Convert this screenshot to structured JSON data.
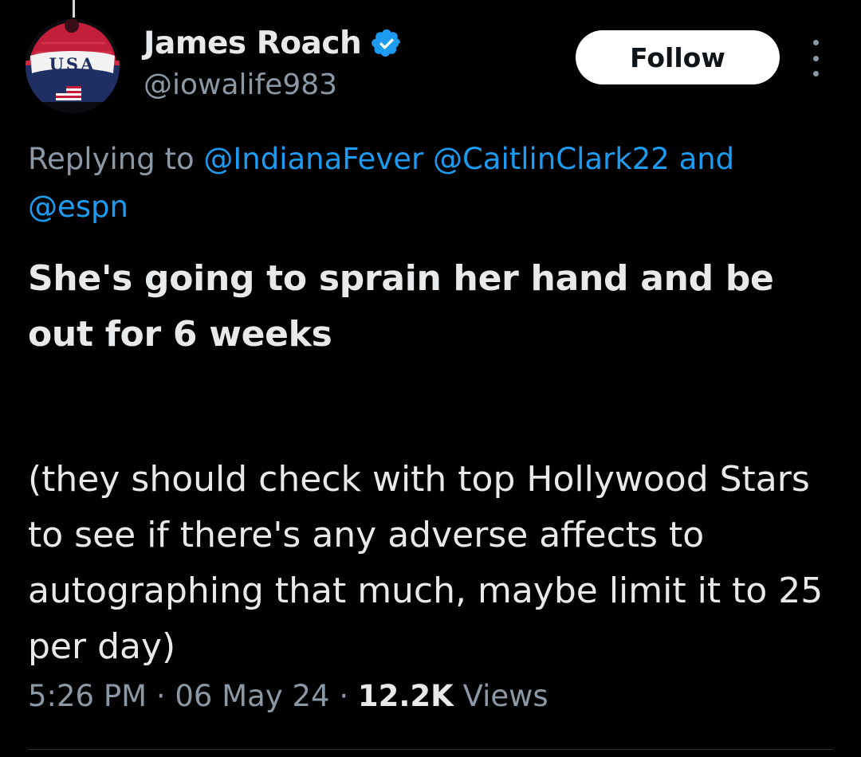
{
  "author": {
    "display_name": "James Roach",
    "handle": "@iowalife983",
    "verified": true,
    "avatar_text": "USA"
  },
  "actions": {
    "follow_label": "Follow",
    "more_icon": "more-vertical-icon"
  },
  "reply_context": {
    "prefix": "Replying to",
    "mentions": [
      "@IndianaFever",
      "@CaitlinClark22",
      "@espn"
    ],
    "conjunction": "and"
  },
  "tweet": {
    "paragraph1": "She's going to sprain her hand and be out for 6 weeks",
    "paragraph2": "(they should check with top Hollywood Stars to see if there's any adverse affects to autographing that much, maybe limit it to 25 per day)"
  },
  "meta": {
    "time": "5:26 PM",
    "separator": "·",
    "date": "06 May 24",
    "views_count": "12.2K",
    "views_label": "Views"
  },
  "colors": {
    "background": "#000000",
    "text_primary": "#e7e9ea",
    "text_secondary": "#8b98a5",
    "link": "#1d9bf0",
    "verified_badge": "#1d9bf0"
  }
}
